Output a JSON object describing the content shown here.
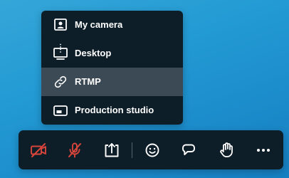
{
  "colors": {
    "menu_background": "#0e1e29",
    "active_item_background": "#3c4a55",
    "off_icon_red": "#d9453a",
    "icon_white": "#ffffff"
  },
  "share_menu": {
    "items": [
      {
        "label": "My camera",
        "icon": "camera-person-icon"
      },
      {
        "label": "Desktop",
        "icon": "monitor-icon"
      },
      {
        "label": "RTMP",
        "icon": "link-icon",
        "highlighted": true
      },
      {
        "label": "Production studio",
        "icon": "production-studio-icon"
      }
    ]
  },
  "toolbar": {
    "buttons": [
      {
        "icon": "video-off-icon",
        "state": "off"
      },
      {
        "icon": "microphone-off-icon",
        "state": "off"
      },
      {
        "icon": "share-screen-icon"
      },
      {
        "icon": "emoji-icon"
      },
      {
        "icon": "chat-bubble-icon"
      },
      {
        "icon": "raise-hand-icon"
      },
      {
        "icon": "more-options-icon"
      }
    ]
  }
}
